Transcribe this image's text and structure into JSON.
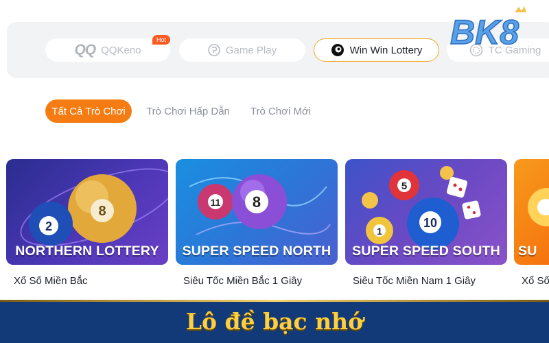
{
  "brand": {
    "logo_text": "BK8"
  },
  "providers": [
    {
      "label": "QQKeno",
      "mark": "QQ",
      "icon": "qq-logo-icon",
      "badge": "Hot",
      "active": false
    },
    {
      "label": "Game Play",
      "icon": "gameplay-icon",
      "active": false
    },
    {
      "label": "Win Win Lottery",
      "icon": "winwin-icon",
      "active": true
    },
    {
      "label": "TC Gaming",
      "icon": "tc-gaming-icon",
      "active": false
    }
  ],
  "tabs": [
    {
      "label": "Tất Cả Trò Chơi",
      "active": true
    },
    {
      "label": "Trò Chơi Hấp Dẫn",
      "active": false
    },
    {
      "label": "Trò Chơi Mới",
      "active": false
    }
  ],
  "games": [
    {
      "banner": "NORTHERN LOTTERY",
      "name": "Xổ Số Miền Bắc",
      "balls": [
        "2",
        "8"
      ]
    },
    {
      "banner": "SUPER SPEED NORTH",
      "name": "Siêu Tốc Miền Bắc 1 Giây",
      "balls": [
        "8",
        "11"
      ]
    },
    {
      "banner": "SUPER SPEED SOUTH",
      "name": "Siêu Tốc Miền Nam 1 Giây",
      "balls": [
        "10",
        "5",
        "1"
      ]
    },
    {
      "banner": "SU",
      "name": "Xổ Số",
      "balls": []
    }
  ],
  "footer_banner": {
    "title": "Lô đề bạc nhớ"
  },
  "colors": {
    "accent": "#f47c12",
    "hot": "#ff5a1f",
    "banner_bg": "#123a78",
    "banner_text": "#ffcf3d"
  }
}
